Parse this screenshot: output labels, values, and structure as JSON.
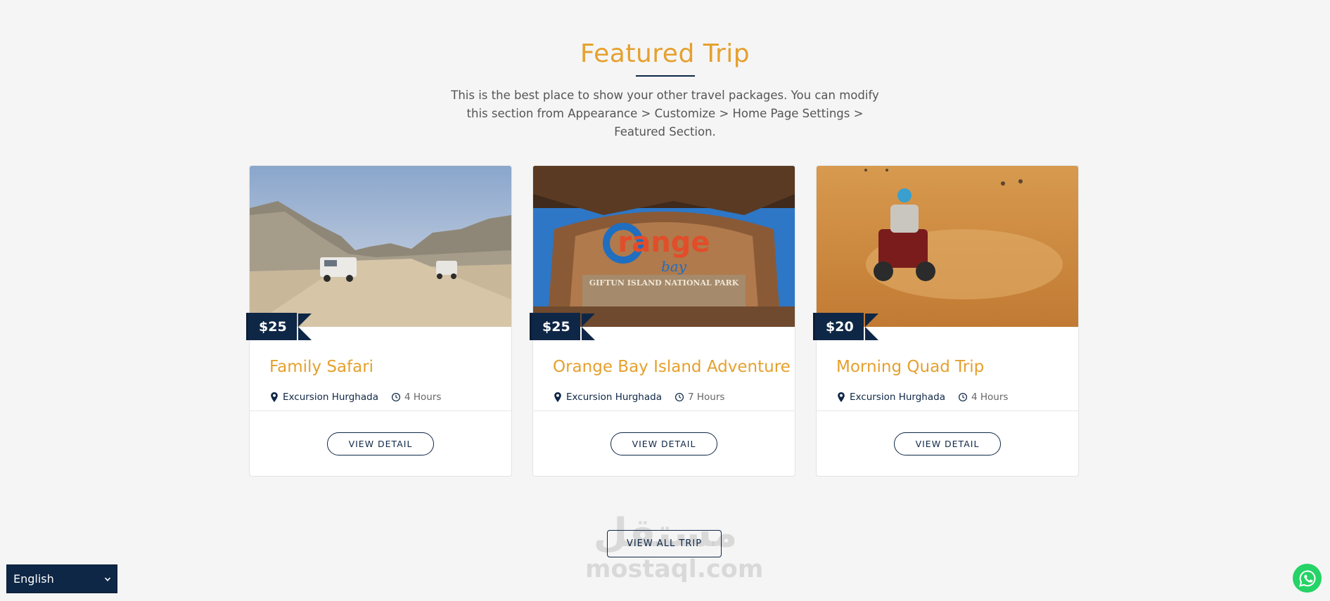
{
  "section": {
    "title": "Featured Trip",
    "description": "This is the best place to show your other travel packages. You can modify this section from Appearance > Customize > Home Page Settings > Featured Section."
  },
  "trips": [
    {
      "price": "$25",
      "title": "Family Safari",
      "location": "Excursion Hurghada",
      "duration": "4 Hours",
      "button": "VIEW DETAIL"
    },
    {
      "price": "$25",
      "title": "Orange Bay Island Adventure",
      "location": "Excursion Hurghada",
      "duration": "7 Hours",
      "button": "VIEW DETAIL"
    },
    {
      "price": "$20",
      "title": "Morning Quad Trip",
      "location": "Excursion Hurghada",
      "duration": "4 Hours",
      "button": "VIEW DETAIL"
    }
  ],
  "view_all": "VIEW ALL TRIP",
  "watermark": {
    "glyph": "مستقل",
    "text": "mostaql.com"
  },
  "language": {
    "selected": "English"
  },
  "icons": {
    "location": "map-pin-icon",
    "duration": "clock-icon",
    "chat": "whatsapp-icon",
    "dropdown": "chevron-down-icon"
  },
  "colors": {
    "accent": "#e5a02e",
    "navy": "#0f2746",
    "whatsapp": "#25d366"
  }
}
